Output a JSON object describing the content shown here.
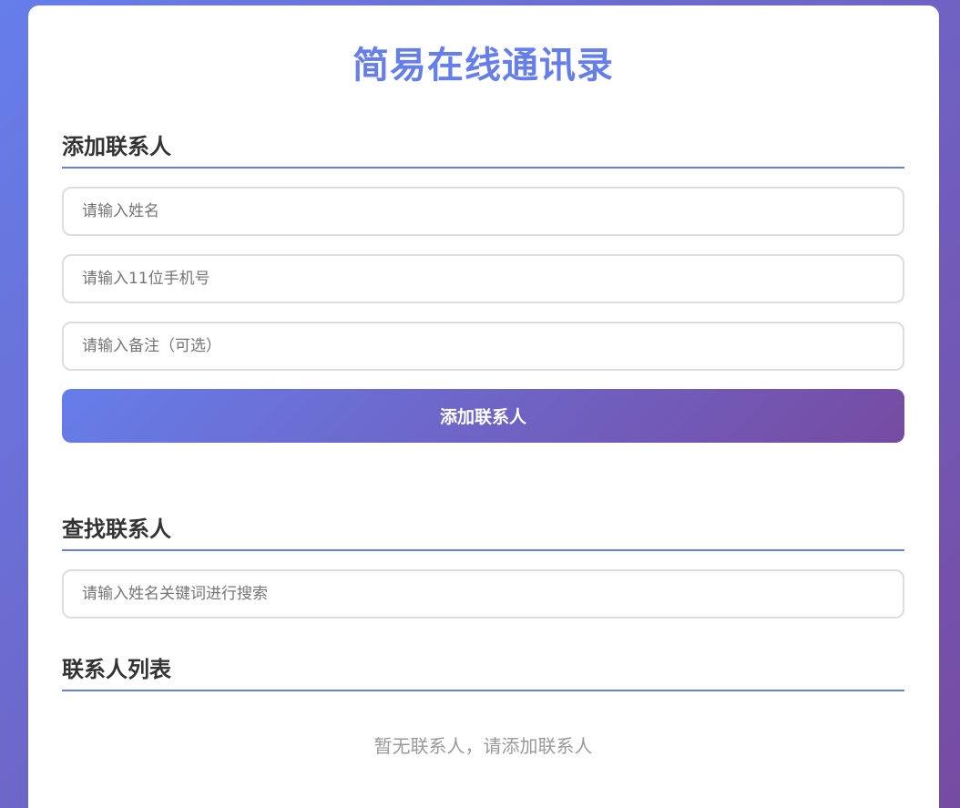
{
  "page": {
    "title": "简易在线通讯录"
  },
  "add_section": {
    "heading": "添加联系人",
    "name_placeholder": "请输入姓名",
    "phone_placeholder": "请输入11位手机号",
    "note_placeholder": "请输入备注（可选）",
    "submit_label": "添加联系人"
  },
  "search_section": {
    "heading": "查找联系人",
    "search_placeholder": "请输入姓名关键词进行搜索"
  },
  "list_section": {
    "heading": "联系人列表",
    "empty_text": "暂无联系人，请添加联系人"
  },
  "colors": {
    "accent": "#667eea",
    "gradient_end": "#764ba2"
  }
}
